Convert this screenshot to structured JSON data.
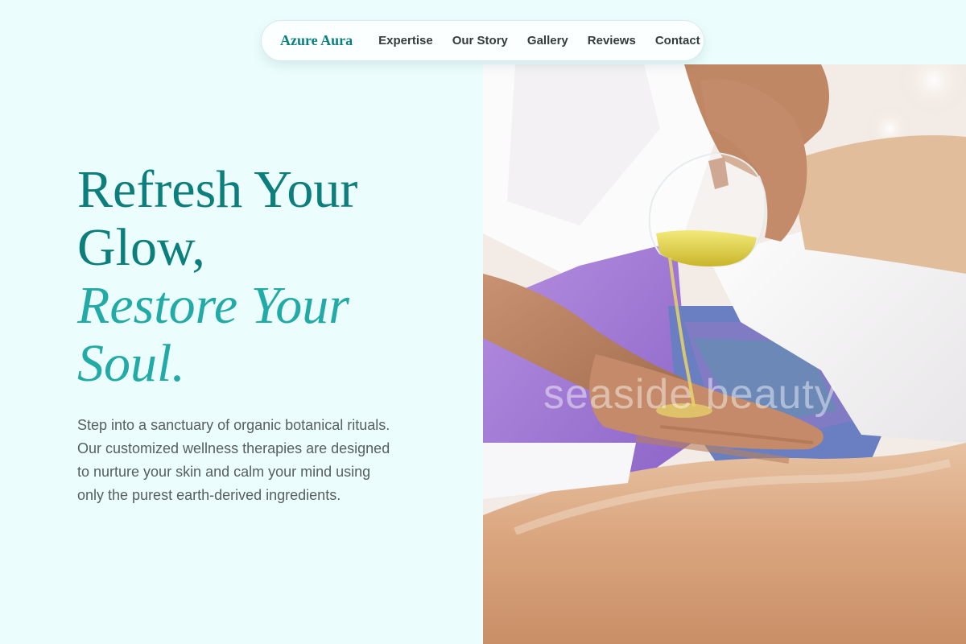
{
  "nav": {
    "brand": "Azure Aura",
    "links": [
      "Expertise",
      "Our Story",
      "Gallery",
      "Reviews",
      "Contact"
    ]
  },
  "hero": {
    "headline_line1": "Refresh Your",
    "headline_line2": "Glow,",
    "headline_accent1": "Restore Your",
    "headline_accent2": "Soul",
    "headline_accent_dot": ".",
    "intro": "Step into a sanctuary of organic botanical rituals. Our customized wellness therapies are designed to nurture your skin and calm your mind using only the purest earth-derived ingredients."
  },
  "image": {
    "watermark": "seaside beauty"
  },
  "colors": {
    "background": "#ecfdfd",
    "brand": "#0b7f7f",
    "headline": "#0c7e7c",
    "accent": "#22aaa6",
    "body_text": "#55605f",
    "nav_text": "#333b3b"
  }
}
